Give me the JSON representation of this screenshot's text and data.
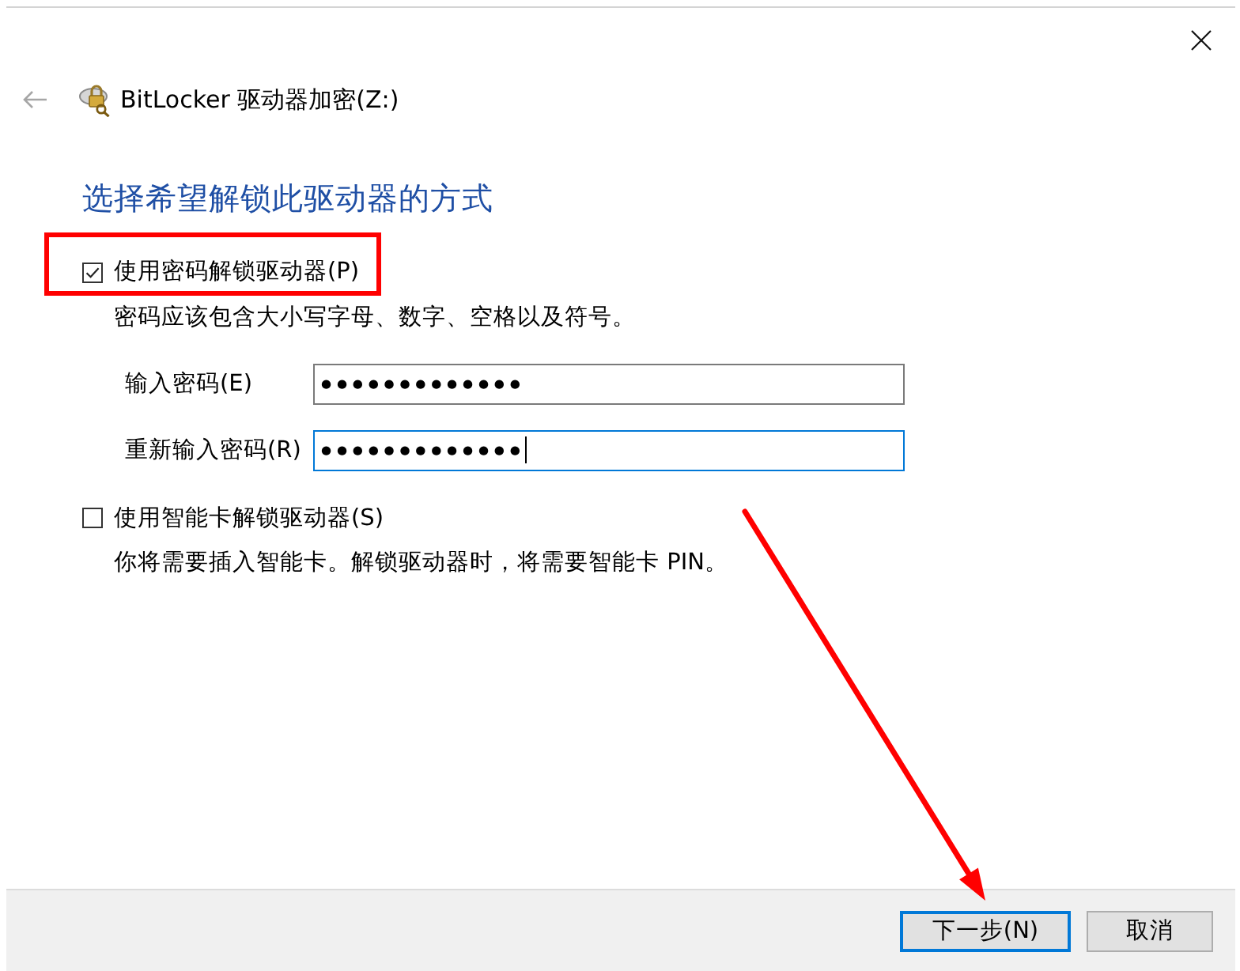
{
  "window": {
    "title": "BitLocker 驱动器加密(Z:)"
  },
  "heading": "选择希望解锁此驱动器的方式",
  "options": [
    {
      "label": "使用密码解锁驱动器(P)",
      "checked": true,
      "highlighted": true,
      "hint": "密码应该包含大小写字母、数字、空格以及符号。",
      "fields": [
        {
          "label": "输入密码(E)",
          "value": "●●●●●●●●●●●●●",
          "focused": false
        },
        {
          "label": "重新输入密码(R)",
          "value": "●●●●●●●●●●●●●",
          "focused": true
        }
      ]
    },
    {
      "label": "使用智能卡解锁驱动器(S)",
      "checked": false,
      "highlighted": false,
      "hint": "你将需要插入智能卡。解锁驱动器时，将需要智能卡 PIN。"
    }
  ],
  "buttons": [
    {
      "label": "下一步(N)",
      "default": true,
      "arrow_to": true
    },
    {
      "label": "取消",
      "default": false,
      "arrow_to": false
    }
  ]
}
